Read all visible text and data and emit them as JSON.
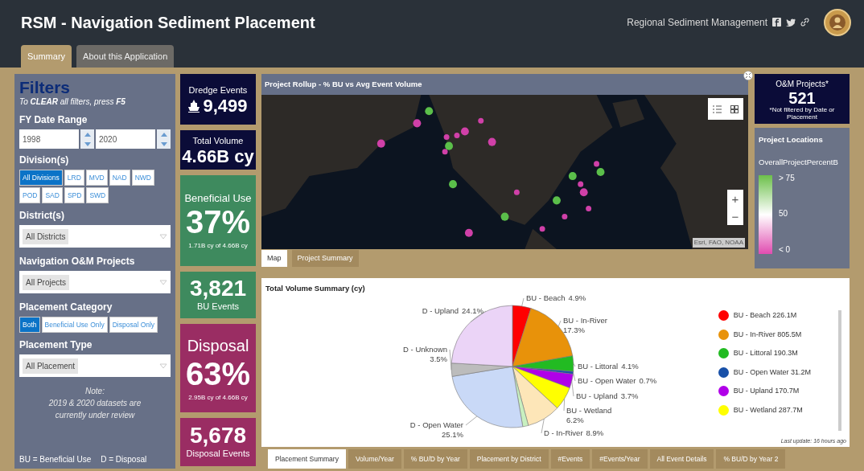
{
  "header": {
    "title": "RSM - Navigation Sediment Placement",
    "org_link": "Regional Sediment Management"
  },
  "tabs": [
    {
      "label": "Summary",
      "selected": true
    },
    {
      "label": "About this Application",
      "selected": false
    }
  ],
  "filters": {
    "title": "Filters",
    "hint": "To **CLEAR** all filters, press **F5**",
    "date_range": {
      "label": "FY Date Range",
      "from": "1998",
      "to": "2020"
    },
    "divisions": {
      "label": "Division(s)",
      "options": [
        {
          "label": "All Divisions",
          "selected": true
        },
        {
          "label": "LRD",
          "selected": false
        },
        {
          "label": "MVD",
          "selected": false
        },
        {
          "label": "NAD",
          "selected": false
        },
        {
          "label": "NWD",
          "selected": false
        },
        {
          "label": "POD",
          "selected": false
        },
        {
          "label": "SAD",
          "selected": false
        },
        {
          "label": "SPD",
          "selected": false
        },
        {
          "label": "SWD",
          "selected": false
        }
      ]
    },
    "district": {
      "label": "District(s)",
      "value": "All Districts"
    },
    "projects": {
      "label": "Navigation O&M Projects",
      "value": "All Projects"
    },
    "category": {
      "label": "Placement Category",
      "options": [
        {
          "label": "Both",
          "selected": true
        },
        {
          "label": "Beneficial Use Only",
          "selected": false
        },
        {
          "label": "Disposal Only",
          "selected": false
        }
      ]
    },
    "type": {
      "label": "Placement Type",
      "value": "All Placement"
    },
    "note": [
      "Note:",
      "2019 & 2020 datasets are",
      "currently under review"
    ],
    "abbreviations": [
      "BU = Beneficial Use",
      "D = Disposal"
    ]
  },
  "stats": [
    {
      "kind": "navy",
      "label": "Dredge Events",
      "value": "9,499",
      "icon": true
    },
    {
      "kind": "navy",
      "label": "Total Volume",
      "value": "4.66B cy"
    },
    {
      "kind": "green",
      "label": "Beneficial Use",
      "value": "37%",
      "sub": "1.71B cy of 4.66B cy"
    },
    {
      "kind": "green",
      "value": "3,821",
      "sub": "BU Events"
    },
    {
      "kind": "magenta",
      "label": "Disposal",
      "value": "63%",
      "sub": "2.95B cy of 4.66B cy"
    },
    {
      "kind": "magenta",
      "value": "5,678",
      "sub": "Disposal Events"
    }
  ],
  "map": {
    "title": "Project Rollup - % BU vs Avg Event Volume",
    "attribution": "Esri, FAO, NOAA",
    "zoom_in": "+",
    "zoom_out": "−",
    "view_tabs": [
      {
        "label": "Map",
        "selected": true
      },
      {
        "label": "Project Summary",
        "selected": false
      }
    ]
  },
  "om_projects": {
    "label": "O&M Projects*",
    "value": "521",
    "note": "*Not filtered by Date or Placement"
  },
  "locations_legend": {
    "title": "Project Locations",
    "field": "OverallProjectPercentB",
    "labels": [
      "> 75",
      "50",
      "< 0"
    ]
  },
  "volume_summary": {
    "title": "Total Volume Summary (cy)",
    "last_update": "Last update: 16 hours ago",
    "chart_data": {
      "type": "pie",
      "data_labels": true,
      "categories": [
        "BU - Beach",
        "BU - In-River",
        "BU - Littoral",
        "BU - Open Water",
        "BU - Upland",
        "BU - Wetland",
        "D - In-River",
        null,
        "D - Open Water",
        "D - Unknown",
        "D - Upland"
      ],
      "values": [
        4.9,
        17.3,
        4.1,
        0.7,
        3.7,
        6.2,
        8.9,
        1.5,
        25.1,
        3.5,
        24.1
      ],
      "value_labels": [
        "4.9%",
        "17.3%",
        "4.1%",
        "0.7%",
        "3.7%",
        "6.2%",
        "8.9%",
        null,
        "25.1%",
        "3.5%",
        "24.1%"
      ],
      "colors": [
        "#ff0000",
        "#e8920a",
        "#22bb22",
        "#1850a8",
        "#b000e8",
        "#ffff00",
        "#fde6b8",
        "#c8f0c0",
        "#c9d9f7",
        "#bcbcbc",
        "#ebd4f7"
      ]
    },
    "legend": [
      {
        "label": "BU - Beach",
        "value": "226.1M",
        "color": "#ff0000"
      },
      {
        "label": "BU - In-River",
        "value": "805.5M",
        "color": "#e8920a"
      },
      {
        "label": "BU - Littoral",
        "value": "190.3M",
        "color": "#22bb22"
      },
      {
        "label": "BU - Open Water",
        "value": "31.2M",
        "color": "#1850a8"
      },
      {
        "label": "BU - Upland",
        "value": "170.7M",
        "color": "#b000e8"
      },
      {
        "label": "BU - Wetland",
        "value": "287.7M",
        "color": "#ffff00"
      }
    ]
  },
  "bottom_tabs": [
    {
      "label": "Placement Summary",
      "selected": true
    },
    {
      "label": "Volume/Year",
      "selected": false
    },
    {
      "label": "% BU/D by Year",
      "selected": false
    },
    {
      "label": "Placement by District",
      "selected": false
    },
    {
      "label": "#Events",
      "selected": false
    },
    {
      "label": "#Events/Year",
      "selected": false
    },
    {
      "label": "All Event Details",
      "selected": false
    },
    {
      "label": "% BU/D by Year 2",
      "selected": false
    }
  ]
}
